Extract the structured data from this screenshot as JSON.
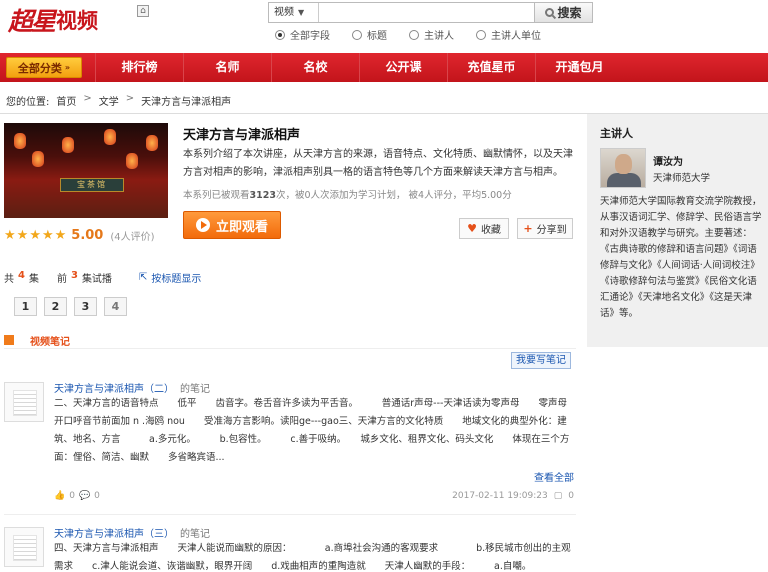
{
  "brand": {
    "logo_mark": "超星",
    "logo_text": "视频"
  },
  "search": {
    "type": "视频",
    "placeholder": "",
    "button": "搜索",
    "options": [
      "全部字段",
      "标题",
      "主讲人",
      "主讲人单位"
    ],
    "selected": "全部字段"
  },
  "nav": {
    "all_label": "全部分类",
    "items": [
      "排行榜",
      "名师",
      "名校",
      "公开课",
      "充值星币",
      "开通包月"
    ]
  },
  "breadcrumb": {
    "prefix": "您的位置:",
    "items": [
      "首页",
      "文学",
      "天津方言与津派相声"
    ],
    "separator": ">"
  },
  "course": {
    "title": "天津方言与津派相声",
    "description": "本系列介绍了本次讲座，从天津方言的来源，语音特点、文化特质、幽默情怀，以及天津方言对相声的影响，津派相声别具一格的语言特色等几个方面来解读天津方言与相声。",
    "stats_pre": "本系列已被观看",
    "views": "3123",
    "stats_mid": "次，被0人次添加为学习计划，  被4人评分，平均5.00分",
    "score": "5.00",
    "score_count": "(4人评价)",
    "watch_label": "立即观看",
    "fav_label": "收藏",
    "share_label": "分享到",
    "cover_plaque": "宝茶馆"
  },
  "episodes": {
    "total_prefix": "共",
    "total": "4",
    "total_suffix": "集",
    "trial_prefix": "前",
    "trial": "3",
    "trial_suffix": "集试播",
    "toggle_label": "按标题显示",
    "pages": [
      "1",
      "2",
      "3",
      "4"
    ]
  },
  "notes": {
    "heading": "视频笔记",
    "write_label": "我要写笔记",
    "items": [
      {
        "title": "天津方言与津派相声（二）",
        "suffix": "的笔记",
        "body": "二、天津方言的语音特点　　低平　　齿音字。卷舌音许多读为平舌音。　　　普通话r声母---天津话读为零声母　　零声母开口呼音节前面加 n .海鸥 nou　　受准海方言影响。读阳ge---gao三、天津方言的文化特质　　地域文化的典型外化：建筑、地名、方言　　　a.多元化。　　　b.包容性。　　　c.善于吸纳。　　城乡文化、租界文化、码头文化　　体现在三个方面：俚俗、简洁、幽默　　多省略宾语...",
        "more": "查看全部",
        "likes": "0",
        "comments": "0",
        "date": "2017-02-11 19:09:23",
        "replies": "0"
      },
      {
        "title": "天津方言与津派相声（三）",
        "suffix": "的笔记",
        "body": "四、天津方言与津派相声　　天津人能说而幽默的原因：　　　　a.商埠社会沟通的客观要求　　　　b.移民城市创出的主观需求　　c.津人能说会道、诙谐幽默，眼界开阔　　d.戏曲相声的重陶造就　　天津人幽默的手段：　　　a.自嘲。"
      }
    ]
  },
  "speaker": {
    "heading": "主讲人",
    "name": "谭汝为",
    "school": "天津师范大学",
    "bio": "天津师范大学国际教育交流学院教授，从事汉语词汇学、修辞学、民俗语言学和对外汉语教学与研究。主要著述：《古典诗歌的修辞和语言问题》《词语修辞与文化》《人间词话·人间词校注》《诗歌修辞句法与鉴赏》《民俗文化语汇通论》《天津地名文化》《这是天津话》等。"
  },
  "colors": {
    "brand_red": "#c8161d",
    "accent_orange": "#f26b0b",
    "link_blue": "#1a56b0",
    "star": "#f2a71b"
  },
  "icons": [
    "home-icon",
    "chevron-down-icon",
    "search-icon",
    "play-icon",
    "heart-icon",
    "plus-icon",
    "external-link-icon",
    "like-icon",
    "comment-icon"
  ]
}
